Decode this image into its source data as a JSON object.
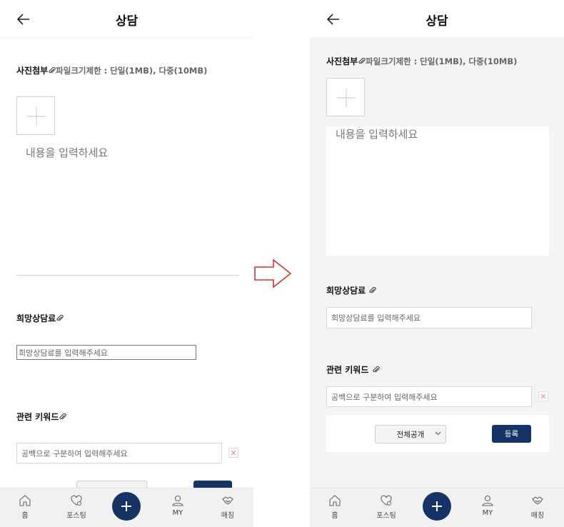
{
  "header": {
    "title": "상담"
  },
  "attachment": {
    "label": "사진첨부",
    "note": "파일크기제한 : 단일(1MB), 다중(10MB)"
  },
  "content": {
    "placeholder": "내용을 입력하세요"
  },
  "fee": {
    "label": "희망상담료",
    "placeholder": "희망상담료를 입력해주세요"
  },
  "keywords": {
    "label": "관련 키워드",
    "placeholder": "공백으로 구분하여 입력해주세요"
  },
  "visibility": {
    "selected": "전체공개"
  },
  "submit": {
    "label": "등록"
  },
  "nav": {
    "home": "홈",
    "posting": "포스팅",
    "my": "MY",
    "matching": "매칭"
  },
  "colors": {
    "brand": "#153465",
    "arrow": "#d0312d",
    "background_right": "#f4f4f4"
  },
  "icons": [
    "back-arrow-icon",
    "paperclip-icon",
    "plus-icon",
    "close-icon",
    "chevron-down-icon",
    "home-icon",
    "heart-bubble-icon",
    "user-icon",
    "handshake-icon",
    "transition-arrow-icon"
  ]
}
